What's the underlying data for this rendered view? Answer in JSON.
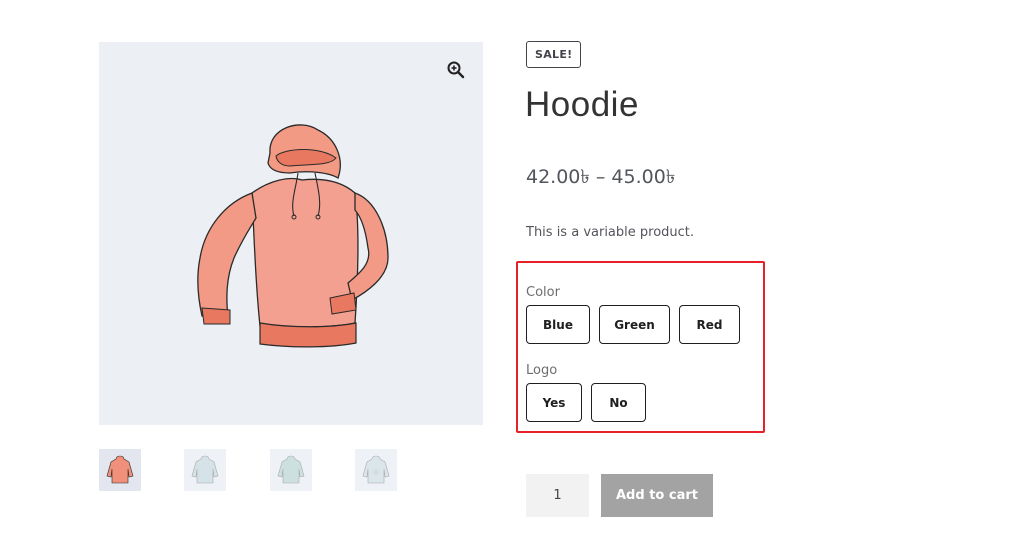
{
  "gallery": {
    "main_image_alt": "",
    "zoom_icon": "zoom-in-icon",
    "thumbnails": [
      {
        "icon": "hoodie-pink-icon"
      },
      {
        "icon": "hoodie-blue-icon"
      },
      {
        "icon": "hoodie-green-icon"
      },
      {
        "icon": "hoodie-logo-icon"
      }
    ]
  },
  "product": {
    "badge": "SALE!",
    "title": "Hoodie",
    "price_range": "42.00৳ – 45.00৳",
    "description": "This is a variable product."
  },
  "variations": {
    "color_label": "Color",
    "color_options": [
      "Blue",
      "Green",
      "Red"
    ],
    "logo_label": "Logo",
    "logo_options": [
      "Yes",
      "No"
    ],
    "highlight_color": "#e8202a"
  },
  "cart": {
    "quantity": "1",
    "add_to_cart_label": "Add to cart"
  },
  "colors": {
    "hoodie": "#f0907a",
    "button_disabled": "#a3a3a3",
    "gallery_bg": "#eceff4"
  }
}
